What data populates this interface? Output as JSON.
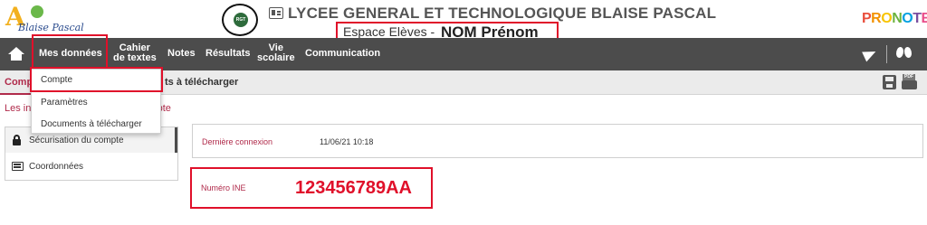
{
  "header": {
    "logo_letter": "A",
    "logo_text": "Blaise Pascal",
    "badge_text": "RGT",
    "school_name": "LYCEE GENERAL ET TECHNOLOGIQUE BLAISE PASCAL",
    "space_label": "Espace Elèves -",
    "user_name": "NOM Prénom",
    "brand": [
      "P",
      "R",
      "O",
      "N",
      "O",
      "T",
      "E"
    ],
    "brand_colors": [
      "#e94e3c",
      "#f39200",
      "#f8c400",
      "#6cb33f",
      "#00a0e1",
      "#7a4fa0",
      "#e94e8a"
    ]
  },
  "nav": {
    "items": [
      {
        "label": "Mes données"
      },
      {
        "label": "Cahier\nde textes"
      },
      {
        "label": "Notes"
      },
      {
        "label": "Résultats"
      },
      {
        "label": "Vie\nscolaire"
      },
      {
        "label": "Communication"
      }
    ],
    "nav_item_0": "Mes données",
    "nav_item_1a": "Cahier",
    "nav_item_1b": "de textes",
    "nav_item_2": "Notes",
    "nav_item_3": "Résultats",
    "nav_item_4a": "Vie",
    "nav_item_4b": "scolaire",
    "nav_item_5": "Communication"
  },
  "dropdown": {
    "items": [
      "Compte",
      "Paramètres",
      "Documents à télécharger"
    ]
  },
  "tabs": {
    "active": "Comp",
    "second": "ts à télécharger"
  },
  "section_title_left": "Les inf",
  "section_title_right": "mpte",
  "left_list": {
    "items": [
      "Sécurisation du compte",
      "Coordonnées"
    ]
  },
  "account": {
    "last_login_label": "Dernière connexion",
    "last_login_value": "11/06/21 10:18",
    "ine_label": "Numéro INE",
    "ine_value": "123456789AA"
  },
  "colors": {
    "nav_bg": "#4c4c4c",
    "accent": "#b02a4a",
    "highlight": "#e0102a"
  },
  "icons": [
    "home-icon",
    "send-icon",
    "butterfly-icon",
    "save-icon",
    "pdf-print-icon",
    "lock-icon",
    "contact-card-icon",
    "school-icon"
  ]
}
